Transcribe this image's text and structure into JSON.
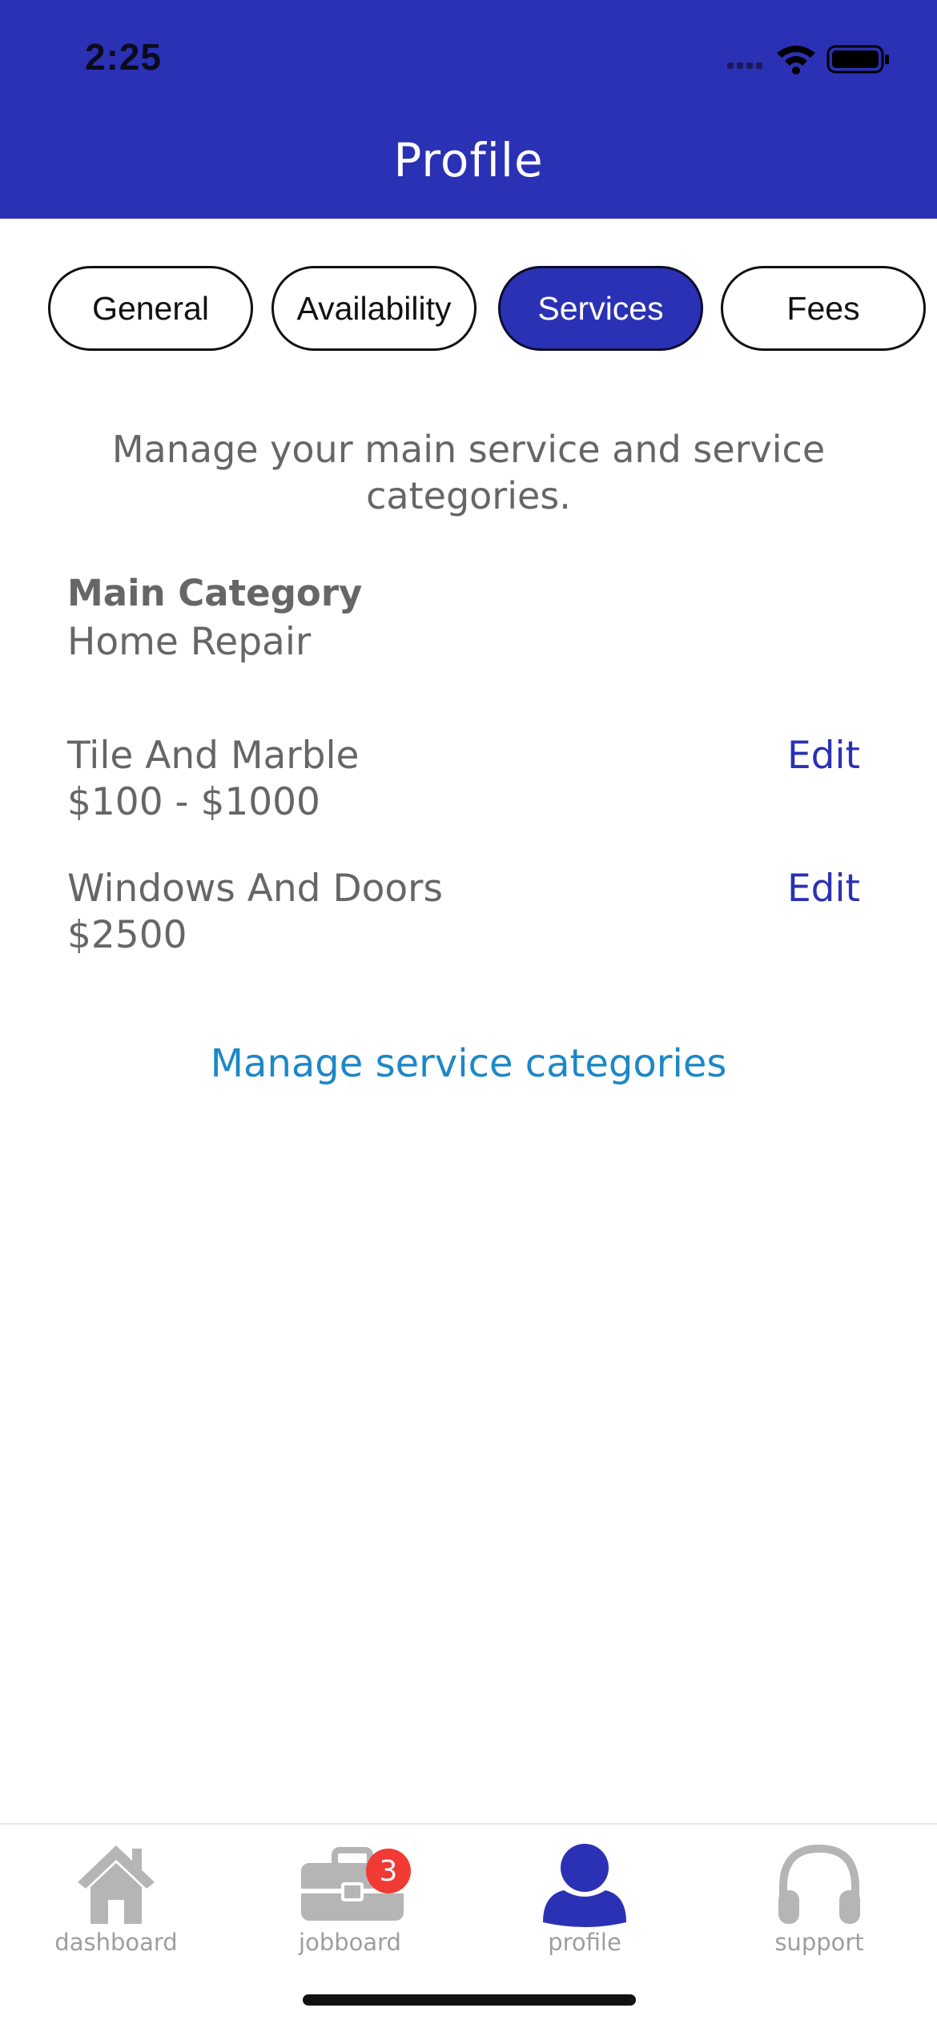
{
  "status_bar": {
    "time": "2:25"
  },
  "header": {
    "title": "Profile"
  },
  "tabs": [
    {
      "label": "General",
      "active": false
    },
    {
      "label": "Availability",
      "active": false
    },
    {
      "label": "Services",
      "active": true
    },
    {
      "label": "Fees",
      "active": false
    }
  ],
  "content": {
    "intro": "Manage your main service and service categories.",
    "main_category_label": "Main Category",
    "main_category_value": "Home Repair",
    "services": [
      {
        "name": "Tile And Marble",
        "price": "$100 - $1000",
        "edit_label": "Edit"
      },
      {
        "name": "Windows And Doors",
        "price": "$2500",
        "edit_label": "Edit"
      }
    ],
    "manage_link": "Manage service categories"
  },
  "bottom_nav": {
    "items": [
      {
        "label": "dashboard",
        "icon": "home-icon",
        "active": false
      },
      {
        "label": "jobboard",
        "icon": "briefcase-icon",
        "active": false,
        "badge": "3"
      },
      {
        "label": "profile",
        "icon": "user-icon",
        "active": true
      },
      {
        "label": "support",
        "icon": "headphones-icon",
        "active": false
      }
    ]
  },
  "colors": {
    "primary": "#2b31b4",
    "link": "#1c88c7",
    "text": "#666666",
    "badge": "#f03a33",
    "inactive_icon": "#b5b5b5"
  }
}
